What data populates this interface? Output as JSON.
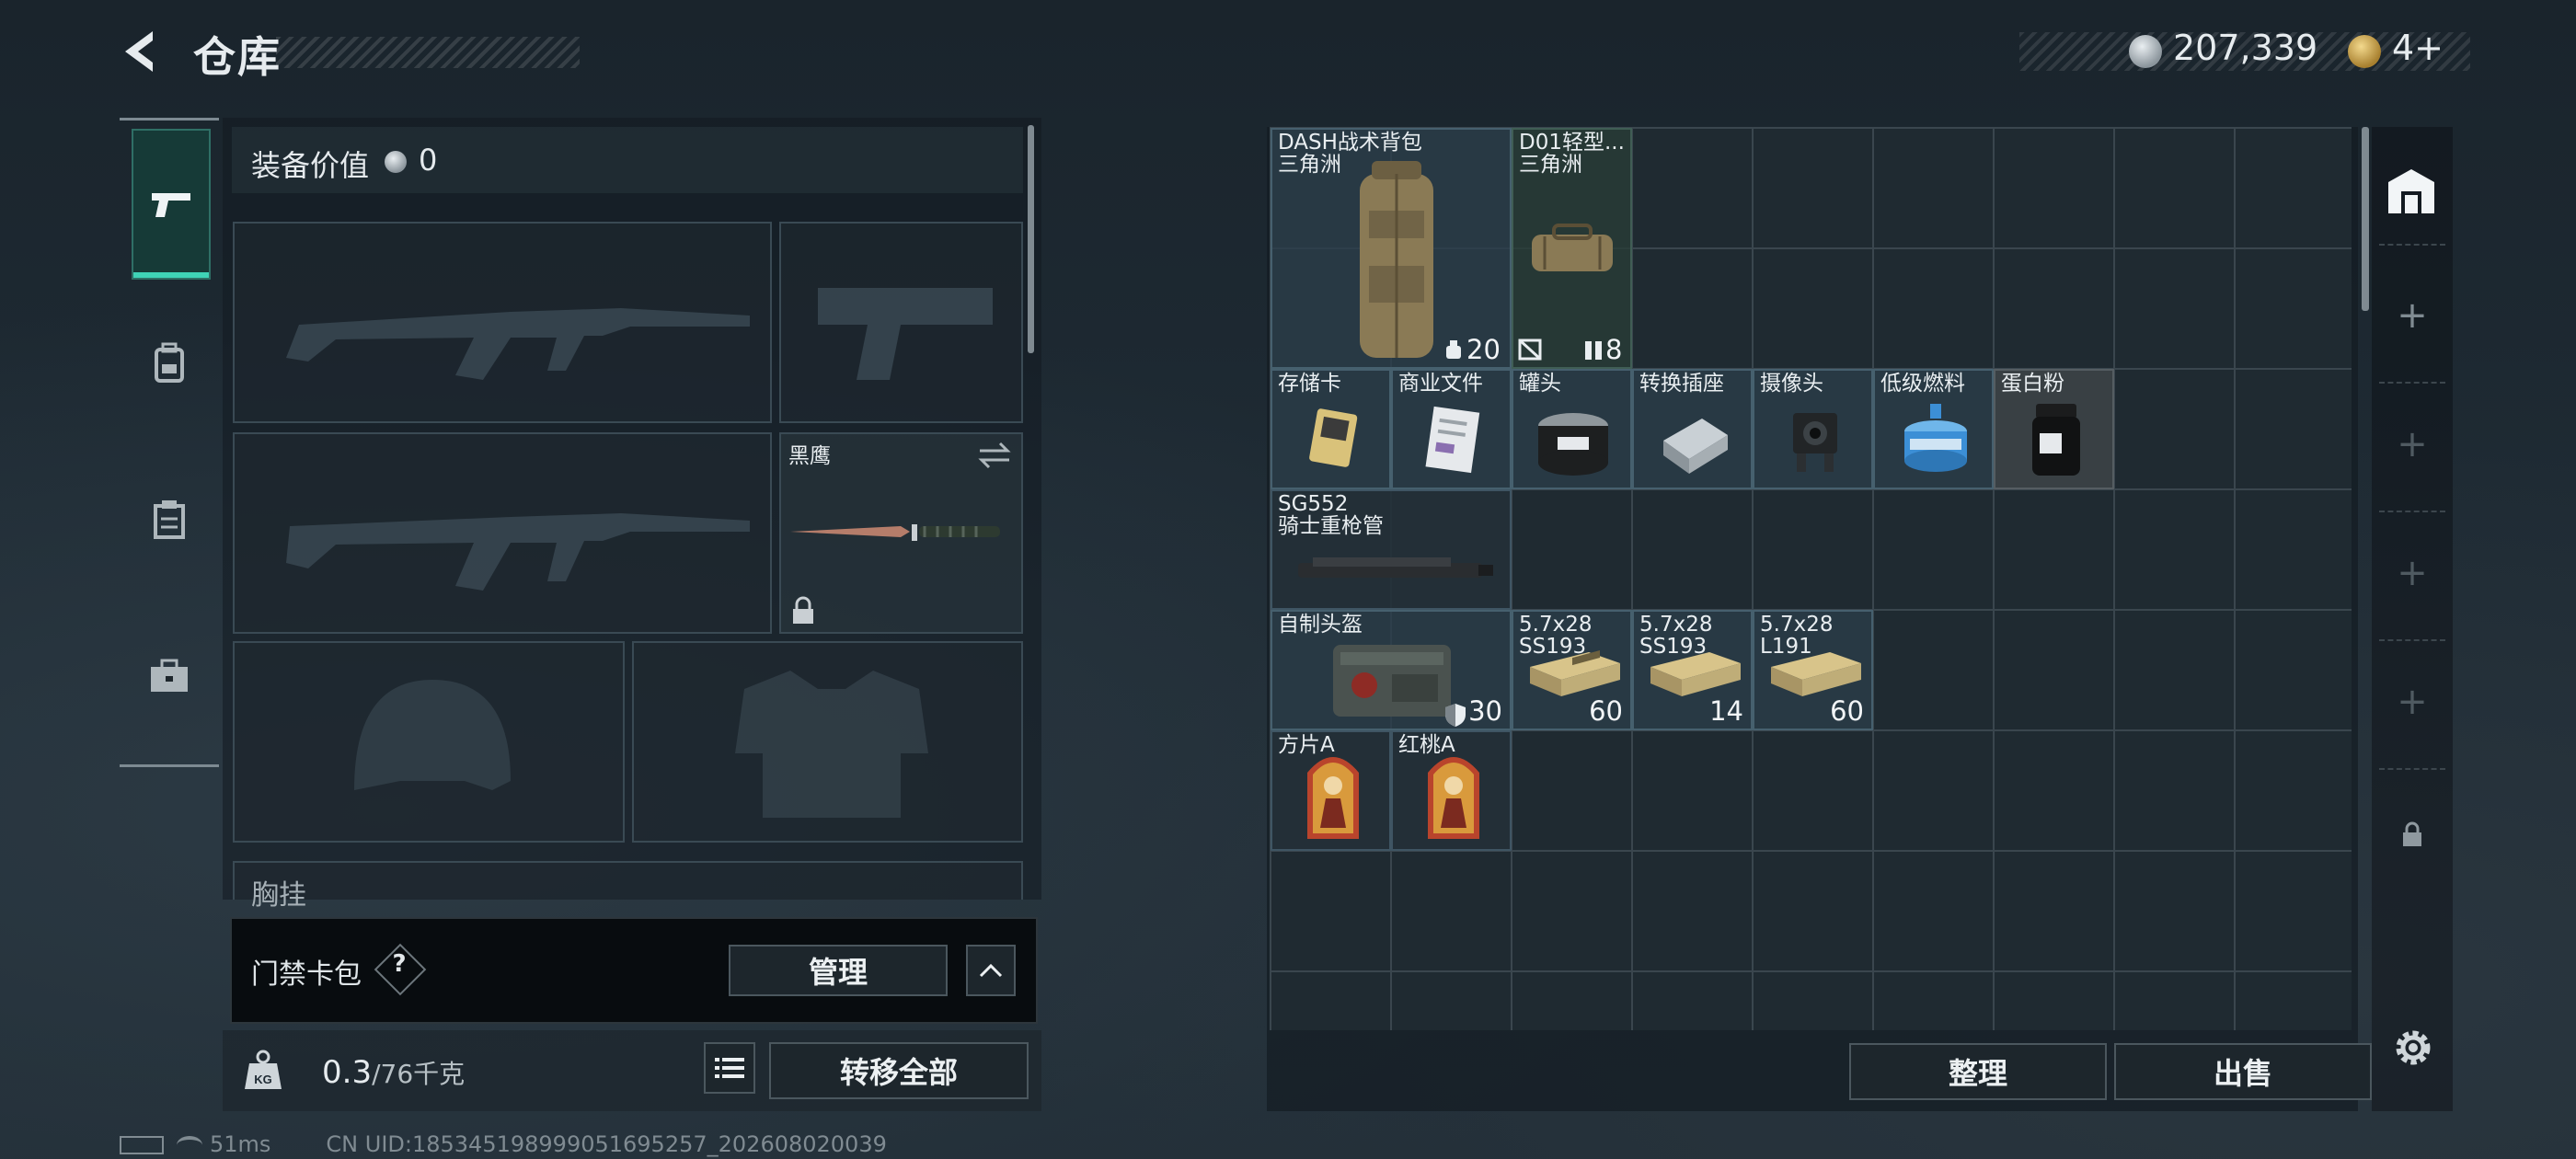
{
  "header": {
    "title": "仓库",
    "currency_primary": "207,339",
    "currency_secondary": "4+"
  },
  "sidebar": {
    "tabs": [
      {
        "icon": "pistol-icon",
        "active": true
      },
      {
        "icon": "backpack-icon",
        "active": false
      },
      {
        "icon": "clipboard-icon",
        "active": false
      },
      {
        "icon": "briefcase-icon",
        "active": false
      }
    ]
  },
  "equipment": {
    "value_label": "装备价值",
    "value": "0",
    "melee_name": "黑鹰",
    "chest_label": "胸挂",
    "keycard_label": "门禁卡包",
    "help_glyph": "?",
    "manage_label": "管理",
    "weight_current": "0.3",
    "weight_max": "/76",
    "weight_unit": "千克",
    "transfer_all_label": "转移全部"
  },
  "storage": {
    "items": [
      {
        "name": "DASH战术背包\n三角洲",
        "badges": [
          "20"
        ]
      },
      {
        "name": "D01轻型...\n三角洲",
        "badges": [
          "8"
        ]
      },
      {
        "name": "存储卡"
      },
      {
        "name": "商业文件"
      },
      {
        "name": "罐头"
      },
      {
        "name": "转换插座"
      },
      {
        "name": "摄像头"
      },
      {
        "name": "低级燃料"
      },
      {
        "name": "蛋白粉"
      },
      {
        "name": "SG552\n骑士重枪管"
      },
      {
        "name": "自制头盔",
        "count": "30"
      },
      {
        "name": "5.7x28\nSS193",
        "count": "60"
      },
      {
        "name": "5.7x28\nSS193",
        "count": "14"
      },
      {
        "name": "5.7x28\nL191",
        "count": "60"
      },
      {
        "name": "方片A"
      },
      {
        "name": "红桃A"
      }
    ],
    "sort_label": "整理",
    "sell_label": "出售"
  },
  "status": {
    "ping": "51ms",
    "uid": "CN UID:18534519899905169525​7_202608020039"
  },
  "colors": {
    "accent": "#3fd3b6",
    "grid_line": "#3a464e"
  }
}
